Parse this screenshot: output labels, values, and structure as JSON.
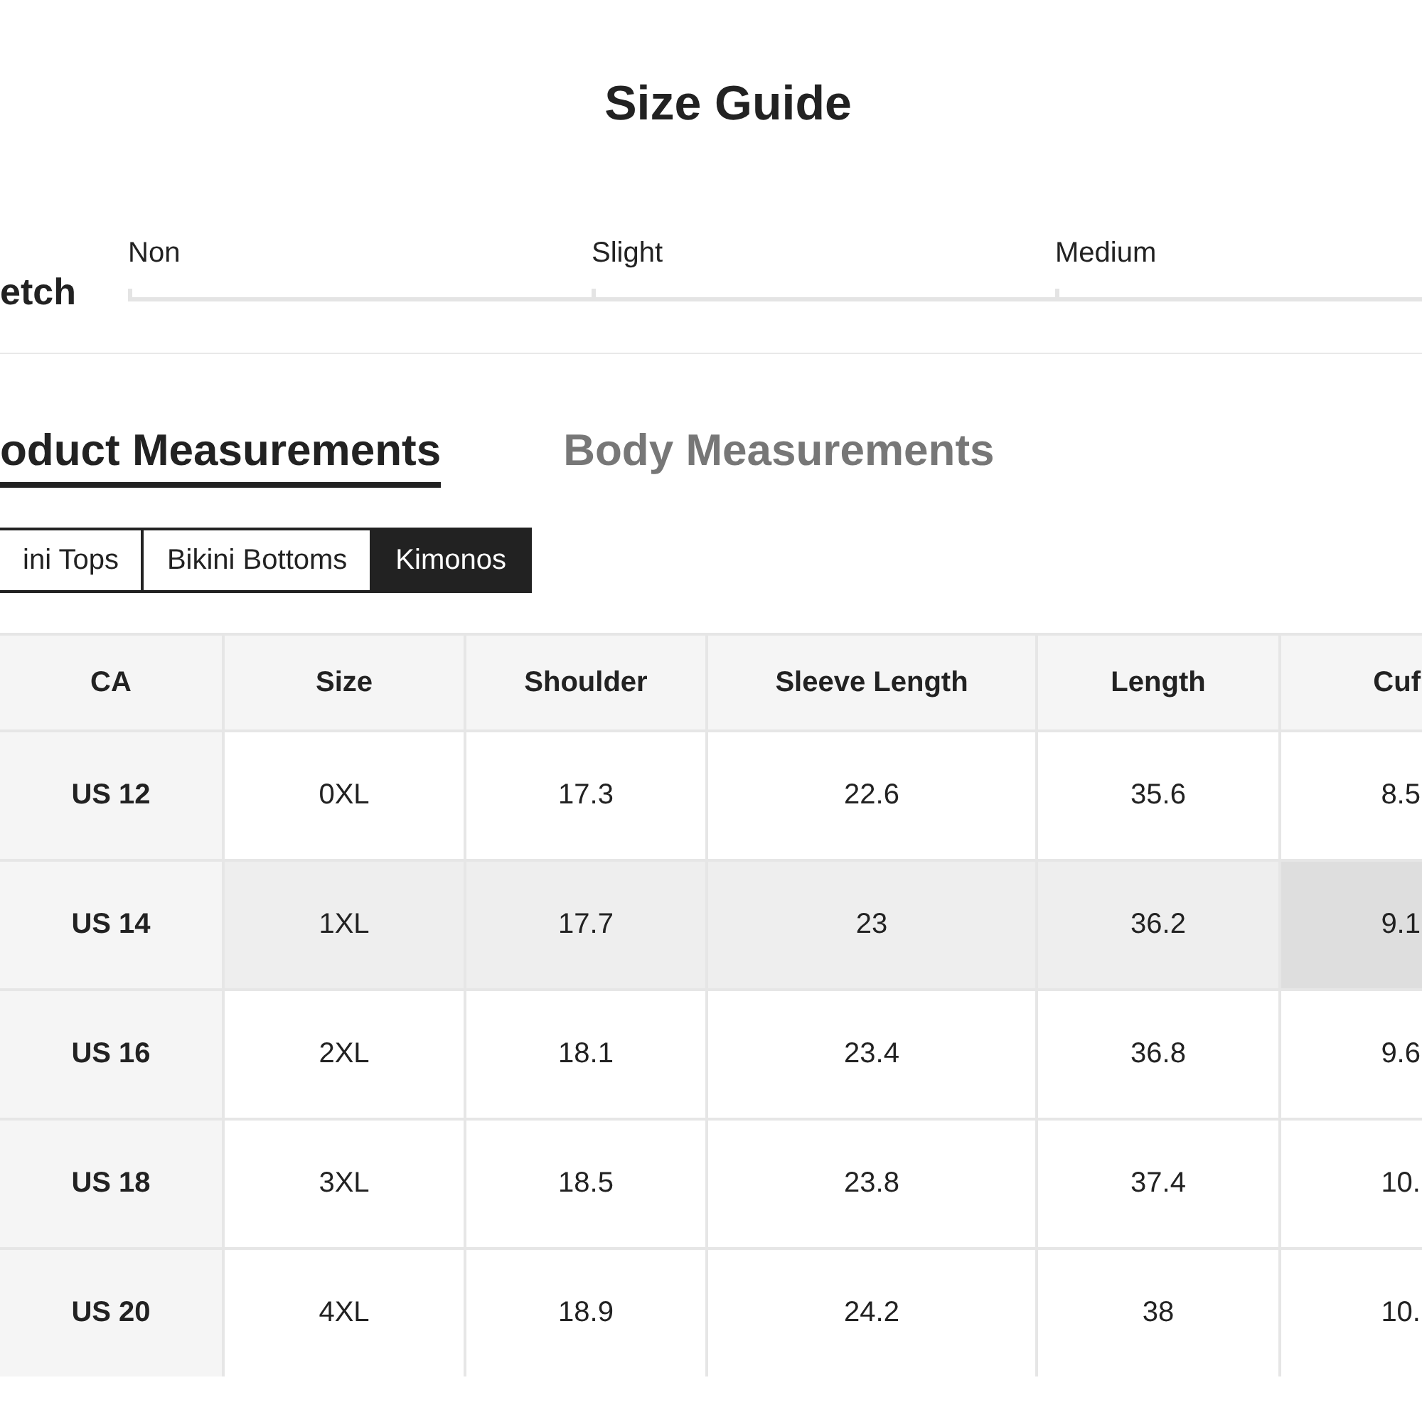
{
  "title": "Size Guide",
  "stretch": {
    "label": "etch",
    "levels": [
      {
        "label": "Non",
        "selected": false
      },
      {
        "label": "Slight",
        "selected": false
      },
      {
        "label": "Medium",
        "selected": false
      }
    ]
  },
  "tabs": [
    {
      "label": "oduct Measurements",
      "selected": true
    },
    {
      "label": "Body Measurements",
      "selected": false
    }
  ],
  "categories": [
    {
      "label": "ini Tops",
      "selected": false
    },
    {
      "label": "Bikini Bottoms",
      "selected": false
    },
    {
      "label": "Kimonos",
      "selected": true
    }
  ],
  "table": {
    "columns": [
      "CA",
      "Size",
      "Shoulder",
      "Sleeve Length",
      "Length",
      "Cuf"
    ],
    "rows": [
      {
        "selected": false,
        "cells": [
          {
            "text": "US 12",
            "hovered": false
          },
          {
            "text": "0XL",
            "hovered": false
          },
          {
            "text": "17.3",
            "hovered": false
          },
          {
            "text": "22.6",
            "hovered": false
          },
          {
            "text": "35.6",
            "hovered": false
          },
          {
            "text": "8.5",
            "hovered": false
          }
        ]
      },
      {
        "selected": true,
        "cells": [
          {
            "text": "US 14",
            "hovered": false
          },
          {
            "text": "1XL",
            "hovered": false
          },
          {
            "text": "17.7",
            "hovered": false
          },
          {
            "text": "23",
            "hovered": false
          },
          {
            "text": "36.2",
            "hovered": false
          },
          {
            "text": "9.1",
            "hovered": true
          }
        ]
      },
      {
        "selected": false,
        "cells": [
          {
            "text": "US 16",
            "hovered": false
          },
          {
            "text": "2XL",
            "hovered": false
          },
          {
            "text": "18.1",
            "hovered": false
          },
          {
            "text": "23.4",
            "hovered": false
          },
          {
            "text": "36.8",
            "hovered": false
          },
          {
            "text": "9.6",
            "hovered": false
          }
        ]
      },
      {
        "selected": false,
        "cells": [
          {
            "text": "US 18",
            "hovered": false
          },
          {
            "text": "3XL",
            "hovered": false
          },
          {
            "text": "18.5",
            "hovered": false
          },
          {
            "text": "23.8",
            "hovered": false
          },
          {
            "text": "37.4",
            "hovered": false
          },
          {
            "text": "10.",
            "hovered": false
          }
        ]
      },
      {
        "selected": false,
        "cells": [
          {
            "text": "US 20",
            "hovered": false
          },
          {
            "text": "4XL",
            "hovered": false
          },
          {
            "text": "18.9",
            "hovered": false
          },
          {
            "text": "24.2",
            "hovered": false
          },
          {
            "text": "38",
            "hovered": false
          },
          {
            "text": "10.",
            "hovered": false
          }
        ]
      }
    ]
  }
}
